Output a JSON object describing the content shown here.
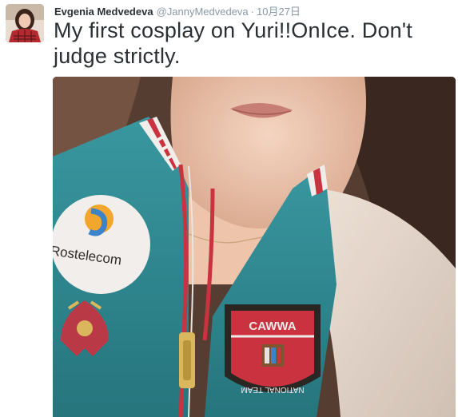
{
  "tweet": {
    "author": {
      "display_name": "Evgenia Medvedeva",
      "handle": "@JannyMedvedeva"
    },
    "separator": "·",
    "timestamp": "10月27日",
    "text": "My first cosplay on Yuri!!OnIce. Don't judge strictly.",
    "photo": {
      "patch_text": "Rostelecom",
      "badge_text": "NATIONAL TEAM"
    }
  },
  "colors": {
    "jacket": "#1f7f8c",
    "stripe": "#c8283a",
    "handle": "#8899a6",
    "name": "#292f33"
  }
}
